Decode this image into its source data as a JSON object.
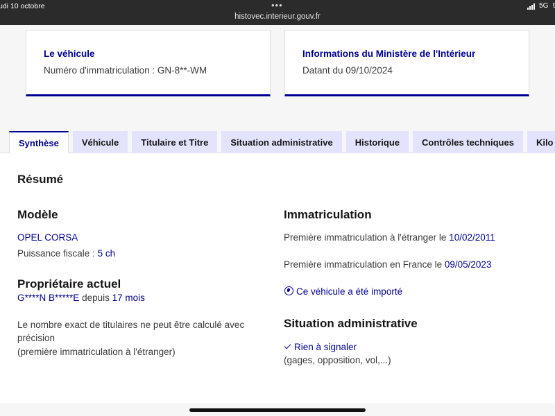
{
  "status_bar": {
    "time": "udi 10 octobre",
    "url": "histovec.interieur.gouv.fr",
    "network": "5G",
    "battery": "9"
  },
  "cards": {
    "vehicle": {
      "title": "Le véhicule",
      "text": "Numéro d'immatriculation : GN-8**-WM"
    },
    "ministry": {
      "title": "Informations du Ministère de l'Intérieur",
      "text": "Datant du 09/10/2024"
    }
  },
  "tabs": [
    "Synthèse",
    "Véhicule",
    "Titulaire et Titre",
    "Situation administrative",
    "Historique",
    "Contrôles techniques",
    "Kilo"
  ],
  "active_tab": "Synthèse",
  "summary": {
    "title": "Résumé",
    "model": {
      "heading": "Modèle",
      "name": "OPEL CORSA",
      "power_label": "Puissance fiscale :",
      "power_value": "5 ch"
    },
    "owner": {
      "heading": "Propriétaire actuel",
      "name": "G****N B*****E",
      "since_label": "depuis",
      "since_value": "17 mois",
      "note_line1": "Le nombre exact de titulaires ne peut être calculé avec",
      "note_line2": "précision",
      "note_line3": "(première immatriculation à l'étranger)"
    },
    "registration": {
      "heading": "Immatriculation",
      "foreign_label": "Première immatriculation à l'étranger le",
      "foreign_date": "10/02/2011",
      "france_label": "Première immatriculation en France le",
      "france_date": "09/05/2023",
      "imported": "Ce véhicule a été importé"
    },
    "admin": {
      "heading": "Situation administrative",
      "status": "Rien à signaler",
      "details": "(gages, opposition, vol,...)"
    }
  },
  "colors": {
    "primary": "#000091",
    "tab_bg": "#e3e3fd"
  }
}
